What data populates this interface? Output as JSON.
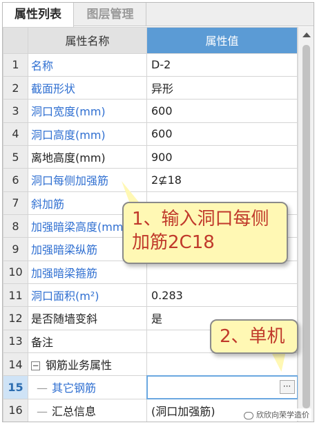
{
  "tabs": [
    {
      "label": "属性列表",
      "active": true
    },
    {
      "label": "图层管理",
      "active": false
    }
  ],
  "table": {
    "headers": {
      "number": "",
      "name": "属性名称",
      "value": "属性值"
    },
    "rows": [
      {
        "num": "1",
        "name": "名称",
        "value": "D-2",
        "name_color": "blue",
        "value_color": "black"
      },
      {
        "num": "2",
        "name": "截面形状",
        "value": "异形",
        "name_color": "blue",
        "value_color": "black"
      },
      {
        "num": "3",
        "name": "洞口宽度(mm)",
        "value": "600",
        "name_color": "blue",
        "value_color": "gray"
      },
      {
        "num": "4",
        "name": "洞口高度(mm)",
        "value": "600",
        "name_color": "blue",
        "value_color": "gray"
      },
      {
        "num": "5",
        "name": "离地高度(mm)",
        "value": "900",
        "name_color": "black",
        "value_color": "black"
      },
      {
        "num": "6",
        "name": "洞口每侧加强筋",
        "value": "2⊈18",
        "name_color": "blue",
        "value_color": "black"
      },
      {
        "num": "7",
        "name": "斜加筋",
        "value": "",
        "name_color": "blue",
        "value_color": "black"
      },
      {
        "num": "8",
        "name": "加强暗梁高度(mm)",
        "value": "",
        "name_color": "blue",
        "value_color": "black"
      },
      {
        "num": "9",
        "name": "加强暗梁纵筋",
        "value": "",
        "name_color": "blue",
        "value_color": "black"
      },
      {
        "num": "10",
        "name": "加强暗梁箍筋",
        "value": "",
        "name_color": "blue",
        "value_color": "black"
      },
      {
        "num": "11",
        "name": "洞口面积(m²)",
        "value": "0.283",
        "name_color": "blue",
        "value_color": "gray"
      },
      {
        "num": "12",
        "name": "是否随墙变斜",
        "value": "是",
        "name_color": "black",
        "value_color": "black"
      },
      {
        "num": "13",
        "name": "备注",
        "value": "",
        "name_color": "black",
        "value_color": "black"
      },
      {
        "num": "14",
        "name": "钢筋业务属性",
        "value": "",
        "name_color": "black",
        "value_color": "black"
      },
      {
        "num": "15",
        "name": "其它钢筋",
        "value": "",
        "name_color": "blue",
        "value_color": "black"
      },
      {
        "num": "16",
        "name": "汇总信息",
        "value": "(洞口加强筋)",
        "name_color": "black",
        "value_color": "black"
      }
    ],
    "expander_symbol": "−",
    "tree_line": "—",
    "ellipsis_label": "···"
  },
  "callouts": {
    "first": "1、输入洞口每侧加筋2C18",
    "second": "2、单机"
  },
  "watermark": "欣欣向荣学造价",
  "colors": {
    "accent_header": "#5b9bd5",
    "label_blue": "#2f6fd1",
    "callout_fill": "#fff8b4",
    "callout_text": "#c0392b"
  }
}
